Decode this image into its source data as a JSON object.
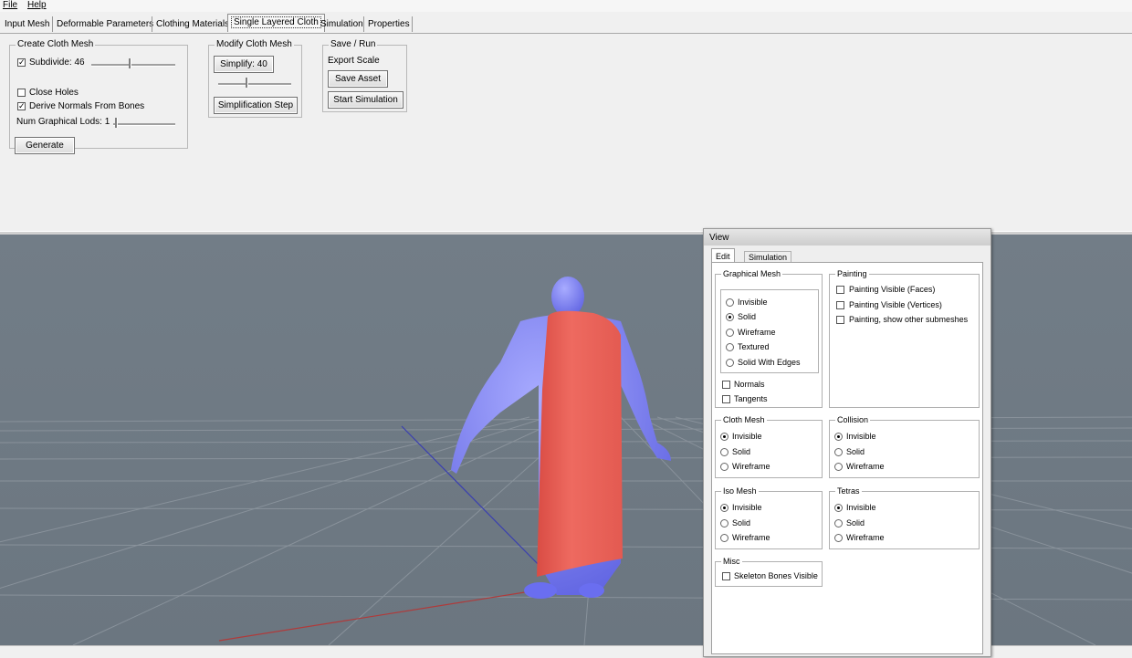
{
  "menu": {
    "file": "File",
    "help": "Help"
  },
  "tabs": [
    "Input Mesh",
    "Deformable Parameters",
    "Clothing Materials",
    "Single Layered Cloth",
    "Simulation",
    "Properties"
  ],
  "create_cloth_mesh": {
    "title": "Create Cloth Mesh",
    "subdivide_label": "Subdivide: 46",
    "subdivide_checked": true,
    "subdivide_slider": 0.45,
    "close_holes_label": "Close Holes",
    "close_holes_checked": false,
    "derive_normals_label": "Derive Normals From Bones",
    "derive_normals_checked": true,
    "num_lods_label": "Num Graphical Lods: 1",
    "num_lods_slider": 0.0,
    "generate_label": "Generate"
  },
  "modify_cloth_mesh": {
    "title": "Modify Cloth Mesh",
    "simplify_label": "Simplify: 40",
    "simplify_slider": 0.4,
    "step_label": "Simplification Step"
  },
  "save_run": {
    "title": "Save / Run",
    "export_scale_label": "Export Scale",
    "save_asset_label": "Save Asset",
    "start_simulation_label": "Start Simulation"
  },
  "view_window": {
    "title": "View",
    "tabs": [
      "Edit",
      "Simulation"
    ],
    "graphical_mesh": {
      "title": "Graphical Mesh",
      "options": [
        "Invisible",
        "Solid",
        "Wireframe",
        "Textured",
        "Solid With Edges"
      ],
      "selected": 1,
      "normals_label": "Normals",
      "tangents_label": "Tangents"
    },
    "painting": {
      "title": "Painting",
      "options": [
        "Painting Visible (Faces)",
        "Painting Visible (Vertices)",
        "Painting, show other submeshes"
      ]
    },
    "cloth_mesh": {
      "title": "Cloth Mesh",
      "options": [
        "Invisible",
        "Solid",
        "Wireframe"
      ],
      "selected": 0
    },
    "collision": {
      "title": "Collision",
      "options": [
        "Invisible",
        "Solid",
        "Wireframe"
      ],
      "selected": 0
    },
    "iso_mesh": {
      "title": "Iso Mesh",
      "options": [
        "Invisible",
        "Solid",
        "Wireframe"
      ],
      "selected": 0
    },
    "tetras": {
      "title": "Tetras",
      "options": [
        "Invisible",
        "Solid",
        "Wireframe"
      ],
      "selected": 0
    },
    "misc": {
      "title": "Misc",
      "skeleton_label": "Skeleton Bones Visible"
    }
  },
  "colors": {
    "viewport_bg": "#6f7a84",
    "character": "#7c7ff2",
    "cloth": "#e65a50",
    "grid": "#8d969e"
  }
}
